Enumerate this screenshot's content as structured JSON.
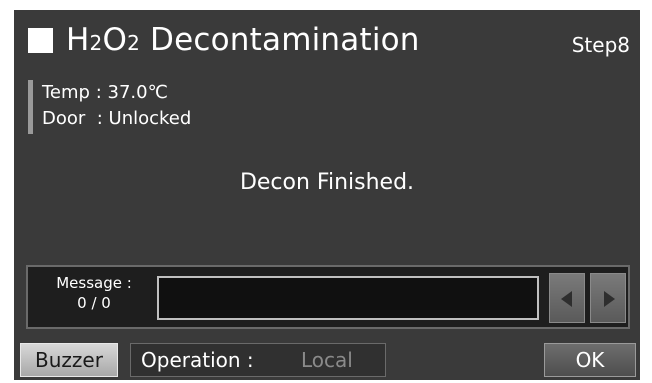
{
  "header": {
    "title_main_1": "H",
    "title_sub_1": "2",
    "title_main_2": "O",
    "title_sub_2": "2",
    "title_rest": " Decontamination",
    "step": "Step8"
  },
  "status": {
    "temp_label": "Temp",
    "temp_value": " : 37.0℃",
    "door_label": "Door",
    "door_value": "  : Unlocked"
  },
  "main_message": "Decon Finished.",
  "message_panel": {
    "label": "Message :",
    "counter": "0 / 0",
    "content": ""
  },
  "bottom": {
    "buzzer_label": "Buzzer",
    "operation_label": "Operation :",
    "operation_value": "Local",
    "ok_label": "OK"
  },
  "colors": {
    "screen_bg": "#3a3a3a",
    "text": "#ffffff",
    "operation_value": "#8a8a8a",
    "buzzer_bg": "#c0c0c0"
  }
}
